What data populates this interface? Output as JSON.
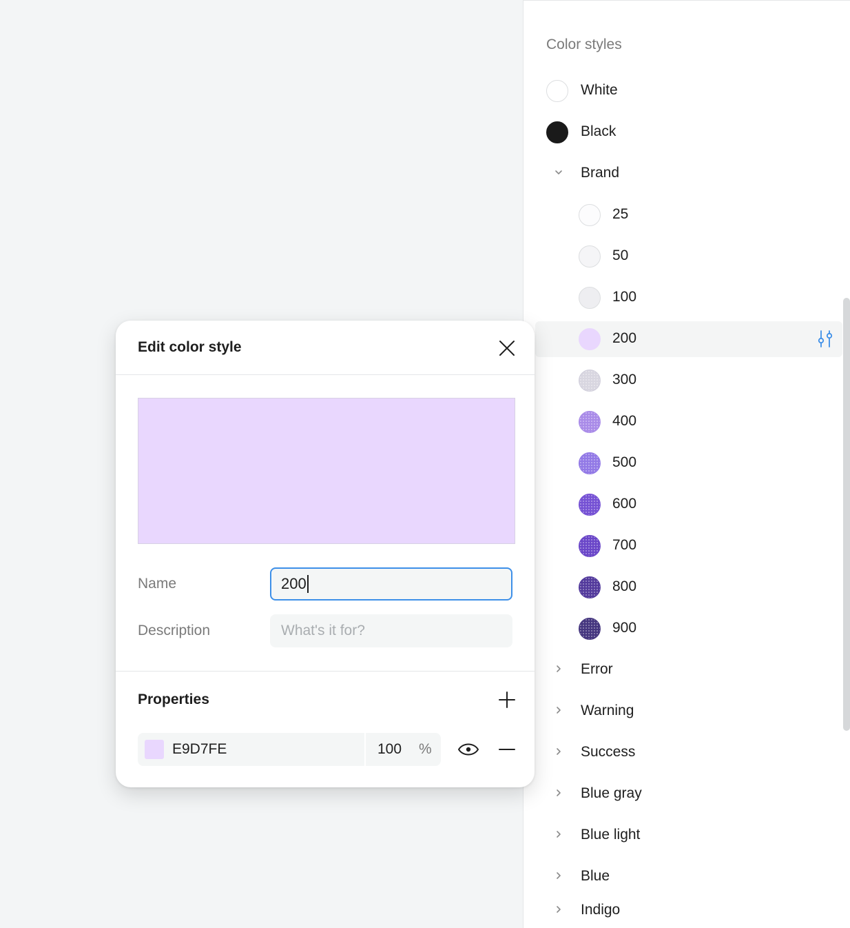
{
  "panel": {
    "title": "Color styles",
    "top_items": [
      {
        "label": "White",
        "color": "#FFFFFF"
      },
      {
        "label": "Black",
        "color": "#1A1A1A"
      }
    ],
    "brand": {
      "label": "Brand",
      "expanded": true,
      "shades": [
        {
          "label": "25",
          "color": "#FCFCFD"
        },
        {
          "label": "50",
          "color": "#F5F5F7"
        },
        {
          "label": "100",
          "color": "#EEEEF1"
        },
        {
          "label": "200",
          "color": "#E9D7FE",
          "selected": true
        },
        {
          "label": "300",
          "color": "#D8D6E0"
        },
        {
          "label": "400",
          "color": "#A98BE8"
        },
        {
          "label": "500",
          "color": "#9279E6"
        },
        {
          "label": "600",
          "color": "#7551D4"
        },
        {
          "label": "700",
          "color": "#6A46C8"
        },
        {
          "label": "800",
          "color": "#533A9C"
        },
        {
          "label": "900",
          "color": "#45367F"
        }
      ]
    },
    "groups": [
      "Error",
      "Warning",
      "Success",
      "Blue gray",
      "Blue light",
      "Blue",
      "Indigo"
    ]
  },
  "dialog": {
    "title": "Edit color style",
    "preview_color": "#E9D7FE",
    "name_label": "Name",
    "name_value": "200",
    "description_label": "Description",
    "description_placeholder": "What's it for?",
    "properties_title": "Properties",
    "property": {
      "hex": "E9D7FE",
      "opacity": "100",
      "unit": "%",
      "color": "#E9D7FE"
    }
  },
  "colors": {
    "accent": "#3D8FE8",
    "icon": "#1E1E1E",
    "muted_text": "#7A7A7A"
  }
}
